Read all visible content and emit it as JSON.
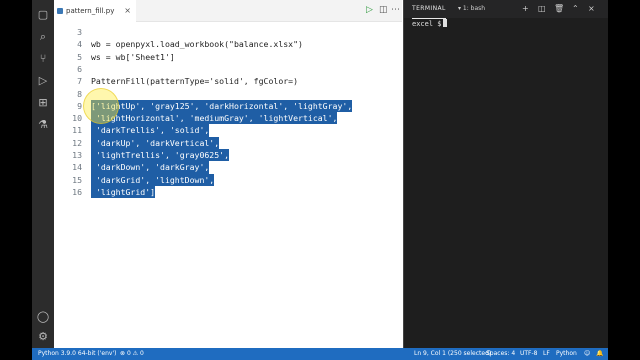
{
  "editor": {
    "tab_label": "pattern_fill.py",
    "tab_close": "×",
    "lines": [
      {
        "n": "3",
        "text": ""
      },
      {
        "n": "4",
        "text": "wb = openpyxl.load_workbook(\"balance.xlsx\")"
      },
      {
        "n": "5",
        "text": "ws = wb['Sheet1']"
      },
      {
        "n": "6",
        "text": ""
      },
      {
        "n": "7",
        "text": "PatternFill(patternType='solid', fgColor=)"
      },
      {
        "n": "8",
        "text": ""
      },
      {
        "n": "9",
        "text": "['lightUp', 'gray125', 'darkHorizontal', 'lightGray',"
      },
      {
        "n": "10",
        "text": " 'lightHorizontal', 'mediumGray', 'lightVertical',"
      },
      {
        "n": "11",
        "text": " 'darkTrellis', 'solid',"
      },
      {
        "n": "12",
        "text": " 'darkUp', 'darkVertical',"
      },
      {
        "n": "13",
        "text": " 'lightTrellis', 'gray0625',"
      },
      {
        "n": "14",
        "text": " 'darkDown', 'darkGray',"
      },
      {
        "n": "15",
        "text": " 'darkGrid', 'lightDown',"
      },
      {
        "n": "16",
        "text": " 'lightGrid']"
      }
    ]
  },
  "terminal": {
    "title": "TERMINAL",
    "shell": "1: bash",
    "prompt": "excel $"
  },
  "statusbar": {
    "interpreter": "Python 3.9.0 64-bit ('env')",
    "errors": "0",
    "warnings": "0",
    "position": "Ln 9, Col 1 (250 selected)",
    "spaces": "Spaces: 4",
    "encoding": "UTF-8",
    "eol": "LF",
    "language": "Python"
  },
  "colors": {
    "selection": "#1f5ea5",
    "statusbar": "#1f6cc0",
    "activitybar": "#2c2c2c",
    "terminal_bg": "#1e1e1e"
  }
}
